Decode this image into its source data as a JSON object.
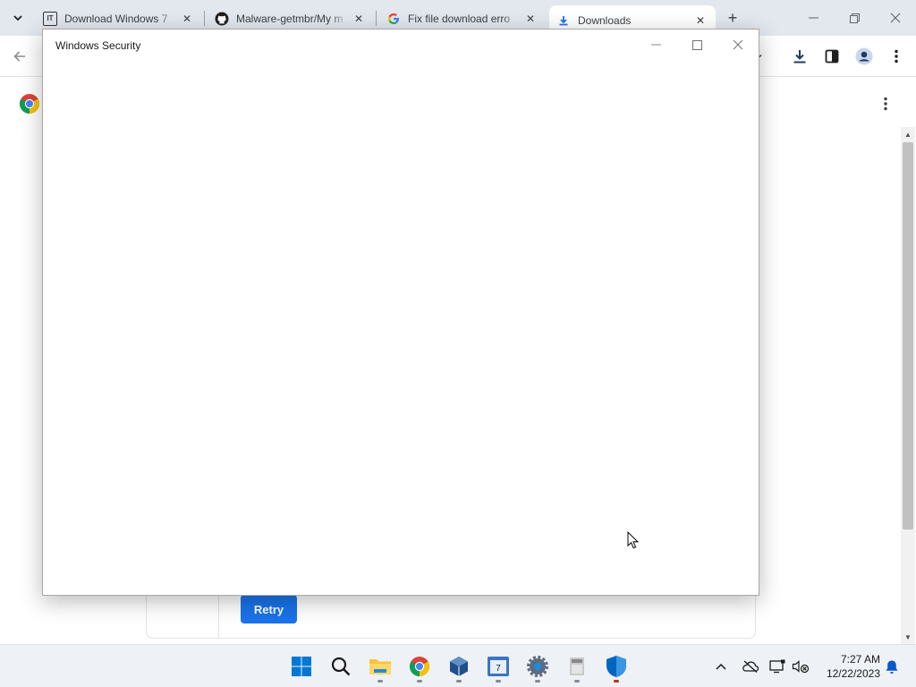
{
  "browser": {
    "tabs": [
      {
        "title": "Download Windows 7",
        "favicon": "it-icon",
        "active": false
      },
      {
        "title": "Malware-getmbr/My m",
        "favicon": "github-icon",
        "active": false
      },
      {
        "title": "Fix file download erro",
        "favicon": "google-icon",
        "active": false
      },
      {
        "title": "Downloads",
        "favicon": "download-icon",
        "active": true
      }
    ],
    "new_tab_icon": "plus-icon",
    "window_controls": [
      "minimize-icon",
      "restore-icon",
      "close-icon"
    ]
  },
  "toolbar": {
    "icons": [
      "back-arrow-icon",
      "download-icon",
      "side-panel-icon",
      "profile-icon",
      "more-vert-icon"
    ]
  },
  "downloads_page": {
    "retry_label": "Retry"
  },
  "dialog": {
    "title": "Windows Security"
  },
  "taskbar": {
    "apps": [
      "start-icon",
      "search-icon",
      "file-explorer-icon",
      "chrome-icon",
      "virtualbox-icon",
      "getmbr-app-icon",
      "settings-icon",
      "archive-app-icon",
      "windows-security-icon"
    ],
    "tray": [
      "show-hidden-icons-chevron",
      "onedrive-offline-icon",
      "display-icon",
      "network-audio-icon",
      "notification-bell-icon"
    ],
    "time": "7:27 AM",
    "date": "12/22/2023"
  },
  "colors": {
    "accent": "#1a73e8",
    "security_blue": "#0067c0"
  }
}
